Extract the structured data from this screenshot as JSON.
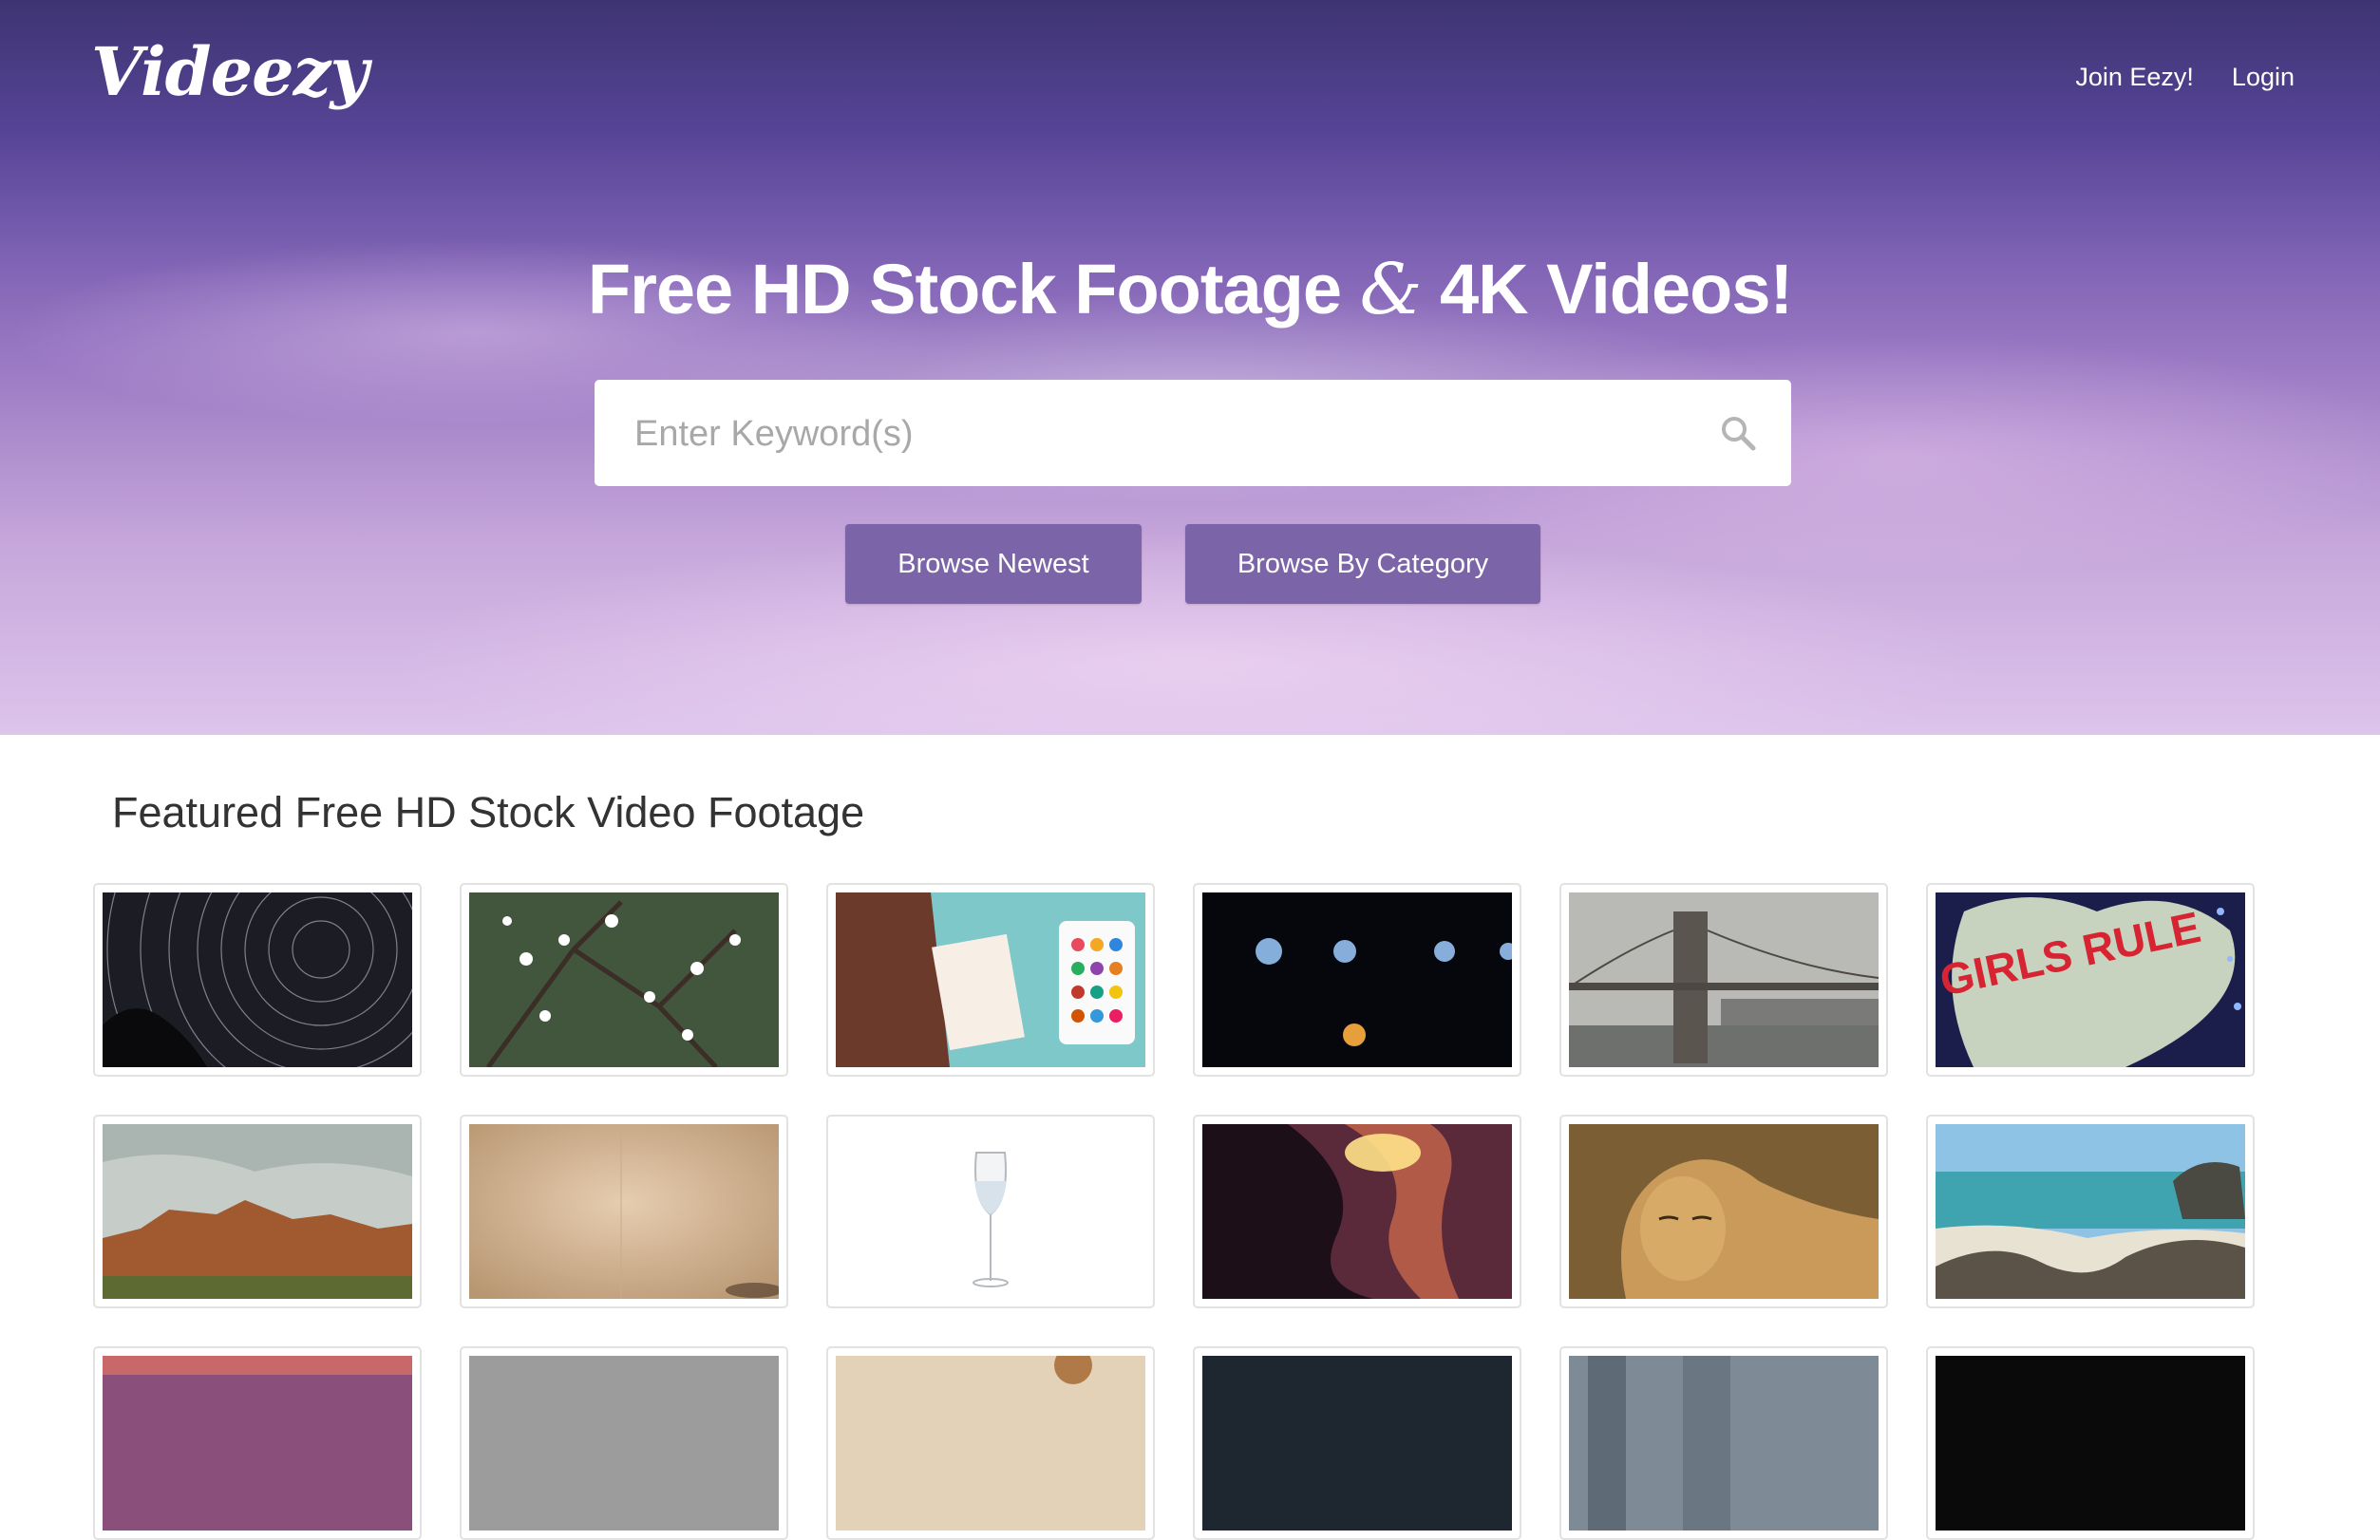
{
  "header": {
    "logo": "Videezy",
    "nav": [
      {
        "label": "Join Eezy!"
      },
      {
        "label": "Login"
      }
    ]
  },
  "hero": {
    "title_part1": "Free HD Stock Footage",
    "title_amp": "&",
    "title_part2": "4K Videos!",
    "search": {
      "placeholder": "Enter Keyword(s)",
      "value": ""
    },
    "buttons": [
      {
        "label": "Browse Newest"
      },
      {
        "label": "Browse By Category"
      }
    ]
  },
  "featured": {
    "title": "Featured Free HD Stock Video Footage",
    "thumbnails": [
      {
        "subject": "star trails"
      },
      {
        "subject": "white blossom branches"
      },
      {
        "subject": "painting valentine card"
      },
      {
        "subject": "bokeh lights sparkler"
      },
      {
        "subject": "brooklyn bridge"
      },
      {
        "subject": "girls rule heart balloon",
        "text": "GIRLS RULE"
      },
      {
        "subject": "desert mesa landscape"
      },
      {
        "subject": "old film paper"
      },
      {
        "subject": "wine glass with water"
      },
      {
        "subject": "antelope canyon"
      },
      {
        "subject": "lioness"
      },
      {
        "subject": "rocky beach"
      },
      {
        "subject": "sunset sky"
      },
      {
        "subject": "grey sky"
      },
      {
        "subject": "food table"
      },
      {
        "subject": "dark scene"
      },
      {
        "subject": "city buildings"
      },
      {
        "subject": "dark scene"
      }
    ]
  },
  "colors": {
    "button_bg": "#7b65a8",
    "hero_top": "#3e3472",
    "hero_bottom": "#dcc4eb",
    "tile_border": "#e2e2e2"
  }
}
